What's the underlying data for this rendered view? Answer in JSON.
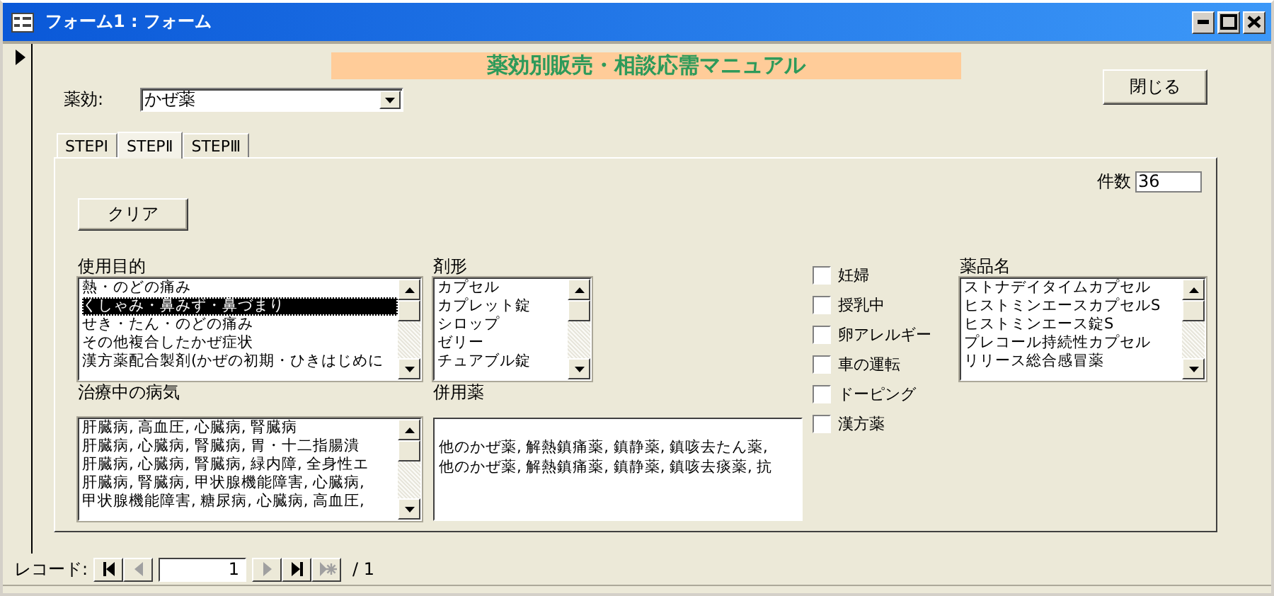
{
  "window": {
    "title": "フォーム1 : フォーム"
  },
  "banner": "薬効別販売・相談応需マニュアル",
  "close_button": "閉じる",
  "drug_field": {
    "label": "薬効:",
    "value": "かぜ薬"
  },
  "tabs": [
    {
      "label": "STEPⅠ",
      "selected": false
    },
    {
      "label": "STEPⅡ",
      "selected": true
    },
    {
      "label": "STEPⅢ",
      "selected": false
    }
  ],
  "count": {
    "label": "件数",
    "value": "36"
  },
  "clear_button": "クリア",
  "purpose_list": {
    "label": "使用目的",
    "items": [
      {
        "text": "熱・のどの痛み",
        "selected": false
      },
      {
        "text": "くしゃみ・鼻みず・鼻づまり",
        "selected": true
      },
      {
        "text": "せき・たん・のどの痛み",
        "selected": false
      },
      {
        "text": "その他複合したかぜ症状",
        "selected": false
      },
      {
        "text": "漢方薬配合製剤(かぜの初期・ひきはじめに",
        "selected": false
      }
    ]
  },
  "form_list": {
    "label": "剤形",
    "items": [
      {
        "text": "カプセル",
        "selected": false
      },
      {
        "text": "カプレット錠",
        "selected": false
      },
      {
        "text": "シロップ",
        "selected": false
      },
      {
        "text": "ゼリー",
        "selected": false
      },
      {
        "text": "チュアブル錠",
        "selected": false
      }
    ]
  },
  "conditions": [
    {
      "label": "妊婦",
      "checked": false
    },
    {
      "label": "授乳中",
      "checked": false
    },
    {
      "label": "卵アレルギー",
      "checked": false
    },
    {
      "label": "車の運転",
      "checked": false
    },
    {
      "label": "ドーピング",
      "checked": false
    },
    {
      "label": "漢方薬",
      "checked": false
    }
  ],
  "product_list": {
    "label": "薬品名",
    "items": [
      {
        "text": "ストナデイタイムカプセル",
        "selected": false
      },
      {
        "text": "ヒストミンエースカプセルS",
        "selected": false
      },
      {
        "text": "ヒストミンエース錠S",
        "selected": false
      },
      {
        "text": "プレコール持続性カプセル",
        "selected": false
      },
      {
        "text": "リリース総合感冒薬",
        "selected": false
      }
    ]
  },
  "disease_list": {
    "label": "治療中の病気",
    "items": [
      {
        "text": "肝臓病, 高血圧, 心臓病, 腎臓病",
        "selected": false
      },
      {
        "text": "肝臓病, 心臓病, 腎臓病, 胃・十二指腸潰",
        "selected": false
      },
      {
        "text": "肝臓病, 心臓病, 腎臓病, 緑内障, 全身性エ",
        "selected": false
      },
      {
        "text": "肝臓病, 腎臓病, 甲状腺機能障害, 心臓病,",
        "selected": false
      },
      {
        "text": "甲状腺機能障害, 糖尿病, 心臓病, 高血圧,",
        "selected": false
      }
    ]
  },
  "concomitant": {
    "label": "併用薬",
    "lines": [
      "他のかぜ薬, 解熱鎮痛薬, 鎮静薬, 鎮咳去たん薬,",
      "他のかぜ薬, 解熱鎮痛薬, 鎮静薬, 鎮咳去痰薬, 抗"
    ]
  },
  "record_nav": {
    "label": "レコード:",
    "current": "1",
    "total": "/ 1",
    "buttons": [
      {
        "kind": "first",
        "disabled": false
      },
      {
        "kind": "prev",
        "disabled": true
      }
    ],
    "buttons_after": [
      {
        "kind": "next",
        "disabled": true
      },
      {
        "kind": "last",
        "disabled": false
      },
      {
        "kind": "new",
        "disabled": true
      }
    ]
  }
}
